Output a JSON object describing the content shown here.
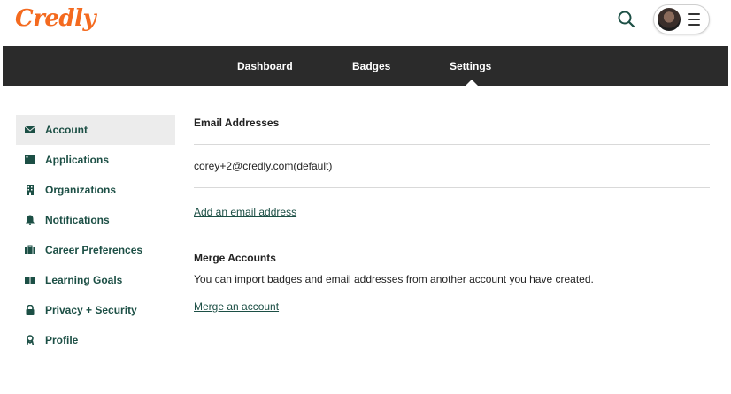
{
  "header": {
    "logo_text": "Credly",
    "search_icon": "search-icon",
    "menu_icon": "hamburger-menu-icon"
  },
  "nav": {
    "items": [
      {
        "label": "Dashboard"
      },
      {
        "label": "Badges"
      },
      {
        "label": "Settings",
        "active": true
      }
    ]
  },
  "sidebar": {
    "items": [
      {
        "label": "Account",
        "icon": "envelope-icon",
        "active": true
      },
      {
        "label": "Applications",
        "icon": "window-icon"
      },
      {
        "label": "Organizations",
        "icon": "building-icon"
      },
      {
        "label": "Notifications",
        "icon": "bell-icon"
      },
      {
        "label": "Career Preferences",
        "icon": "briefcase-icon"
      },
      {
        "label": "Learning Goals",
        "icon": "book-icon"
      },
      {
        "label": "Privacy + Security",
        "icon": "lock-icon"
      },
      {
        "label": "Profile",
        "icon": "person-icon"
      }
    ]
  },
  "main": {
    "email_heading": "Email Addresses",
    "email_value": "corey+2@credly.com(default)",
    "add_email_link": "Add an email address",
    "merge_heading": "Merge Accounts",
    "merge_description": "You can import badges and email addresses from another account you have created.",
    "merge_link": "Merge an account"
  },
  "colors": {
    "brand_orange": "#f46a1f",
    "nav_bg": "#2b2b2b",
    "accent_green": "#1c4f45"
  }
}
